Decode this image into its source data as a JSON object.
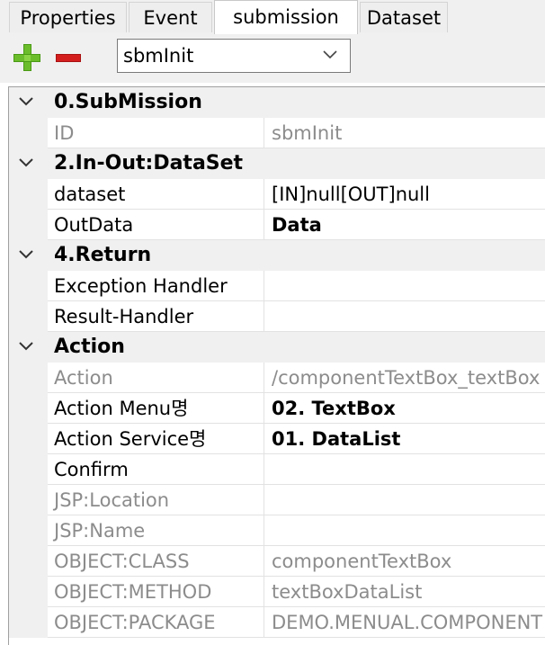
{
  "tabs": [
    {
      "label": "Properties"
    },
    {
      "label": "Event"
    },
    {
      "label": "submission"
    },
    {
      "label": "Dataset"
    }
  ],
  "toolbar": {
    "selected": "sbmInit"
  },
  "groups": [
    {
      "title": "0.SubMission",
      "rows": [
        {
          "name": "ID",
          "value": "sbmInit"
        }
      ]
    },
    {
      "title": "2.In-Out:DataSet",
      "rows": [
        {
          "name": "dataset",
          "value": "[IN]null[OUT]null"
        },
        {
          "name": "OutData",
          "value": "Data"
        }
      ]
    },
    {
      "title": "4.Return",
      "rows": [
        {
          "name": "Exception Handler",
          "value": ""
        },
        {
          "name": "Result-Handler",
          "value": ""
        }
      ]
    },
    {
      "title": "Action",
      "rows": [
        {
          "name": "Action",
          "value": "/componentTextBox_textBox"
        },
        {
          "name": "Action Menu명",
          "value": "02. TextBox"
        },
        {
          "name": "Action Service명",
          "value": "01. DataList"
        },
        {
          "name": "Confirm",
          "value": ""
        },
        {
          "name": "JSP:Location",
          "value": ""
        },
        {
          "name": "JSP:Name",
          "value": ""
        },
        {
          "name": "OBJECT:CLASS",
          "value": "componentTextBox"
        },
        {
          "name": "OBJECT:METHOD",
          "value": "textBoxDataList"
        },
        {
          "name": "OBJECT:PACKAGE",
          "value": "DEMO.MENUAL.COMPONENT"
        }
      ]
    }
  ]
}
